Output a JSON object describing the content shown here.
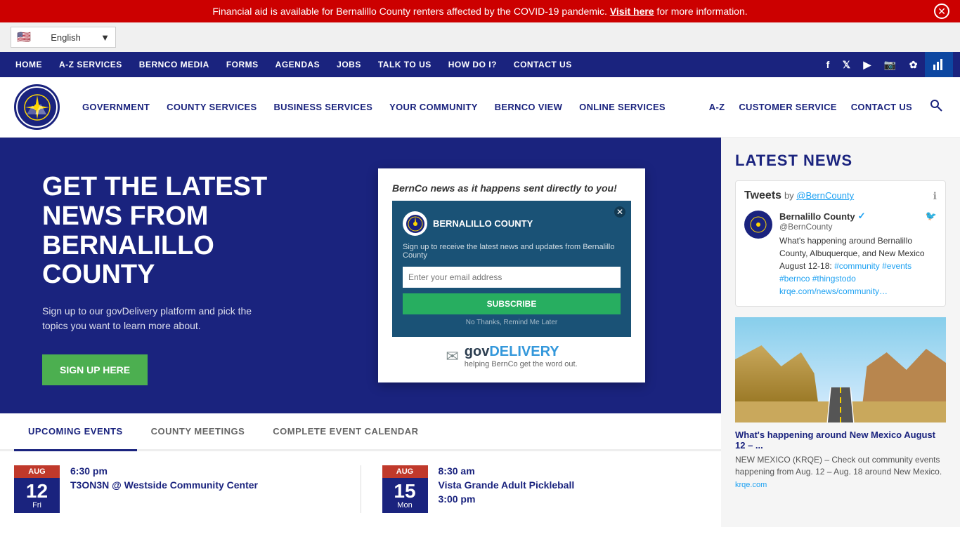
{
  "alert": {
    "text_before": "Financial aid is available for Bernalillo County renters affected by the COVID-19 pandemic.",
    "link_text": "Visit here",
    "text_after": "for more information."
  },
  "language": {
    "selected": "English",
    "flag": "🇺🇸"
  },
  "top_nav": {
    "items": [
      {
        "label": "HOME",
        "id": "home"
      },
      {
        "label": "A-Z SERVICES",
        "id": "az-services"
      },
      {
        "label": "BERNCO MEDIA",
        "id": "bernco-media"
      },
      {
        "label": "FORMS",
        "id": "forms"
      },
      {
        "label": "AGENDAS",
        "id": "agendas"
      },
      {
        "label": "JOBS",
        "id": "jobs"
      },
      {
        "label": "TALK TO US",
        "id": "talk-to-us"
      },
      {
        "label": "HOW DO I?",
        "id": "how-do-i"
      },
      {
        "label": "CONTACT US",
        "id": "contact-us"
      }
    ],
    "social": {
      "facebook": "f",
      "twitter": "t",
      "youtube": "▶",
      "instagram": "📷",
      "flickr": "✿",
      "data": "📊"
    }
  },
  "main_nav": {
    "items": [
      {
        "label": "GOVERNMENT",
        "id": "government"
      },
      {
        "label": "COUNTY SERVICES",
        "id": "county-services"
      },
      {
        "label": "BUSINESS SERVICES",
        "id": "business-services"
      },
      {
        "label": "YOUR COMMUNITY",
        "id": "your-community"
      },
      {
        "label": "BERNCO VIEW",
        "id": "bernco-view"
      },
      {
        "label": "ONLINE SERVICES",
        "id": "online-services"
      }
    ],
    "right_items": [
      {
        "label": "A-Z",
        "id": "az"
      },
      {
        "label": "CUSTOMER SERVICE",
        "id": "customer-service"
      },
      {
        "label": "CONTACT US",
        "id": "contact-us-main"
      }
    ]
  },
  "hero": {
    "heading": "GET THE LATEST NEWS FROM BERNALILLO COUNTY",
    "description": "Sign up to our govDelivery platform and pick the topics you want to learn more about.",
    "signup_button": "Sign Up Here",
    "card": {
      "tagline": "BernCo news as it happens sent directly to you!",
      "badge_text": "BERNALILLO COUNTY",
      "signup_desc": "Sign up to receive the latest news and updates from Bernalillo County",
      "email_placeholder": "Enter your email address",
      "subscribe_button": "SUBSCRIBE",
      "no_thanks": "No Thanks, Remind Me Later",
      "govdelivery_logo": "govDELIVERY",
      "govdelivery_tagline": "helping BernCo get the word out."
    }
  },
  "events": {
    "tabs": [
      {
        "label": "UPCOMING EVENTS",
        "active": true
      },
      {
        "label": "COUNTY MEETINGS",
        "active": false
      },
      {
        "label": "COMPLETE EVENT CALENDAR",
        "active": false
      }
    ],
    "items": [
      {
        "month": "AUG",
        "day": "12",
        "weekday": "Fri",
        "time": "6:30 pm",
        "title": "T3ON3N @ Westside Community Center"
      },
      {
        "month": "AUG",
        "day": "15",
        "weekday": "Mon",
        "time": "8:30 am",
        "title": "Vista Grande Adult Pickleball"
      }
    ]
  },
  "sidebar": {
    "latest_news_title": "LATEST NEWS",
    "twitter": {
      "tweets_label": "Tweets",
      "by_label": "by",
      "account": "@BernCounty",
      "account_name": "Bernalillo County",
      "handle": "@BernCounty",
      "tweet_text": "What's happening around Bernalillo County, Albuquerque, and New Mexico August 12-18: #community #events #bernco #thingstodo krqe.com/news/community…"
    },
    "news_item": {
      "title": "What's happening around New Mexico August 12 – ...",
      "text": "NEW MEXICO (KRQE) – Check out community events happening from Aug. 12 – Aug. 18 around New Mexico.",
      "source": "krqe.com"
    }
  }
}
